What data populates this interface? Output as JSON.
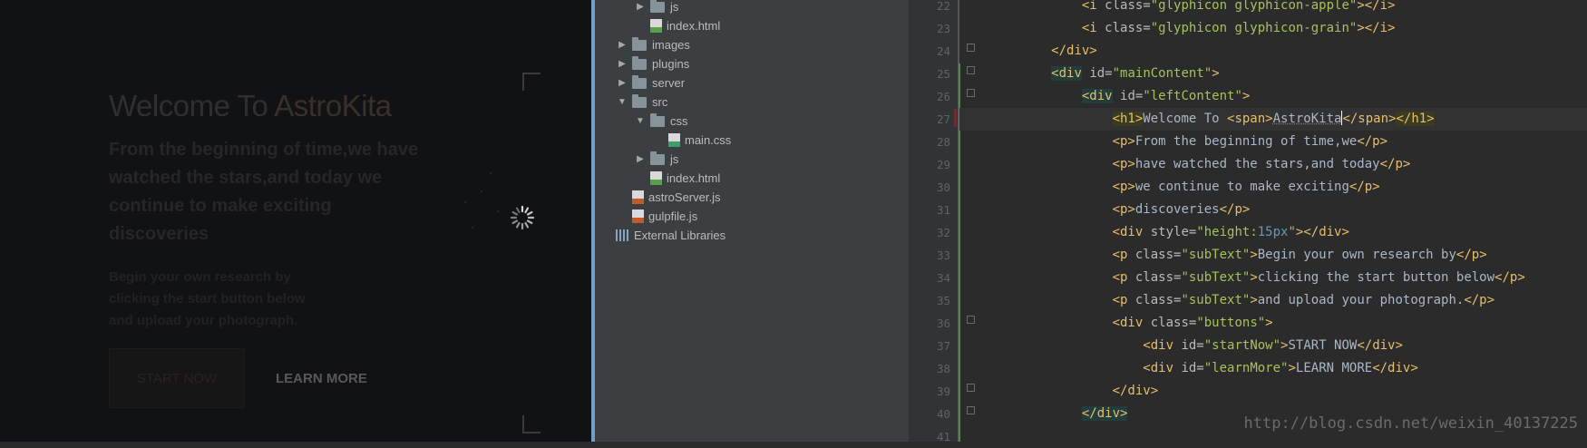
{
  "preview": {
    "title_prefix": "Welcome To ",
    "title_brand": "AstroKita",
    "lead": "From the beginning of time,we have watched the stars,and today we continue to make exciting discoveries",
    "sub_lines": [
      "Begin your own research by",
      "clicking the start button below",
      "and upload your photograph."
    ],
    "start_button": "START NOW",
    "learn_button": "LEARN MORE"
  },
  "tree": {
    "items": [
      {
        "label": "js",
        "type": "folder",
        "state": "collapsed"
      },
      {
        "label": "index.html",
        "type": "html"
      },
      {
        "label": "images",
        "type": "folder",
        "state": "collapsed"
      },
      {
        "label": "plugins",
        "type": "folder",
        "state": "collapsed"
      },
      {
        "label": "server",
        "type": "folder",
        "state": "collapsed"
      },
      {
        "label": "src",
        "type": "folder",
        "state": "expanded"
      },
      {
        "label": "css",
        "type": "folder",
        "state": "expanded"
      },
      {
        "label": "main.css",
        "type": "css"
      },
      {
        "label": "js",
        "type": "folder",
        "state": "collapsed"
      },
      {
        "label": "index.html",
        "type": "html"
      },
      {
        "label": "astroServer.js",
        "type": "js"
      },
      {
        "label": "gulpfile.js",
        "type": "js"
      },
      {
        "label": "External Libraries",
        "type": "library"
      }
    ]
  },
  "editor": {
    "line_numbers": [
      "22",
      "23",
      "24",
      "25",
      "26",
      "27",
      "28",
      "29",
      "30",
      "31",
      "32",
      "33",
      "34",
      "35",
      "36",
      "37",
      "38",
      "39",
      "40",
      "41"
    ],
    "current_line": "27",
    "watermark": "http://blog.csdn.net/weixin_40137225"
  },
  "colors": {
    "tag": "#e8bf6a",
    "attr_value": "#a5c25c",
    "text": "#a9b7c6",
    "number": "#6897bb",
    "tree_selection_border": "#6f9fc8"
  }
}
